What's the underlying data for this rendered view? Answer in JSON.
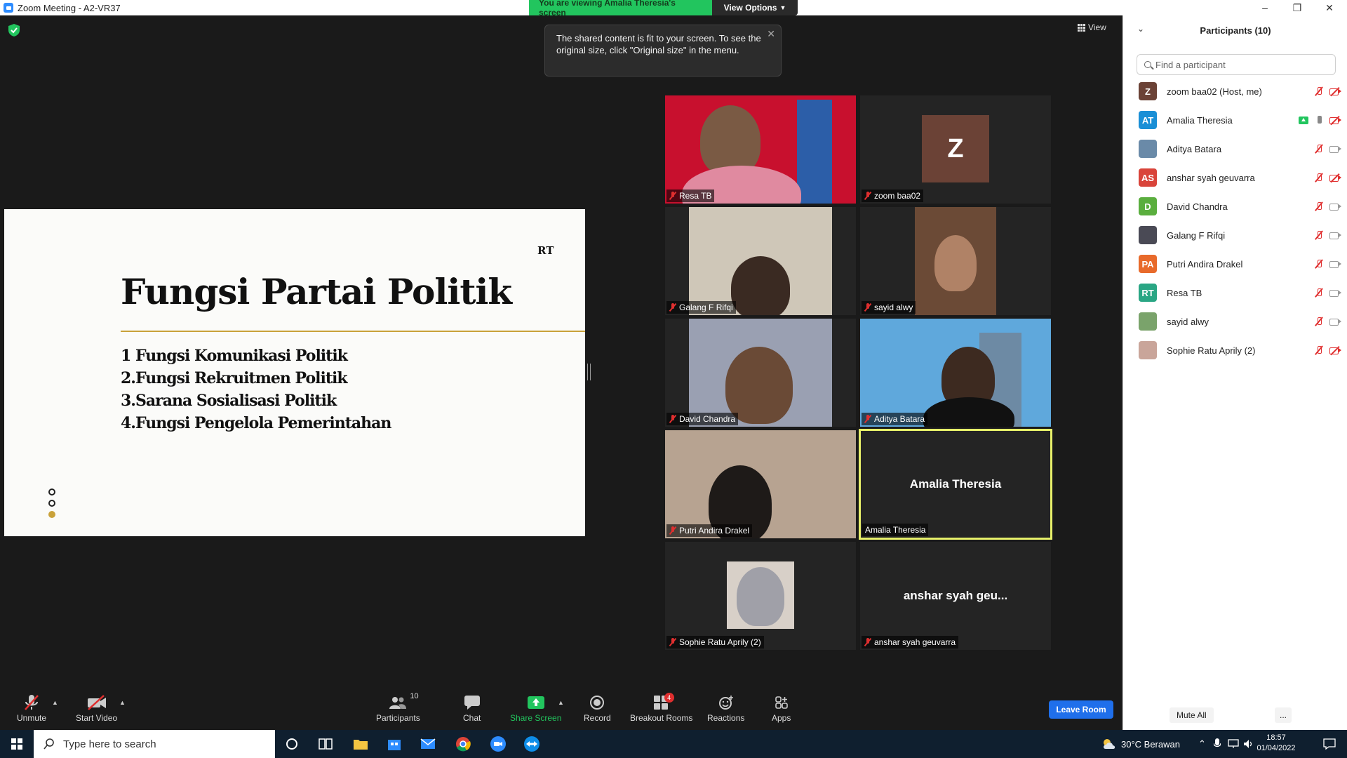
{
  "window": {
    "title": "Zoom Meeting - A2-VR37"
  },
  "share_banner": {
    "viewing": "You are viewing Amalia Theresia's screen",
    "view_options": "View Options"
  },
  "view_button": {
    "label": "View"
  },
  "tooltip": {
    "line1": "The shared content is fit to your screen. To see the",
    "line2": "original size, click \"Original size\" in the menu."
  },
  "slide": {
    "tag": "RT",
    "title": "Fungsi Partai Politik",
    "items": [
      "1 Fungsi Komunikasi Politik",
      "2.Fungsi Rekruitmen Politik",
      "3.Sarana Sosialisasi Politik",
      "4.Fungsi Pengelola Pemerintahan"
    ]
  },
  "video_tiles": [
    {
      "name": "Resa TB",
      "muted": true
    },
    {
      "name": "zoom baa02",
      "muted": true,
      "avatar_letter": "Z"
    },
    {
      "name": "Galang F Rifqi",
      "muted": true
    },
    {
      "name": "sayid alwy",
      "muted": true
    },
    {
      "name": "David Chandra",
      "muted": true
    },
    {
      "name": "Aditya Batara",
      "muted": true
    },
    {
      "name": "Putri Andira Drakel",
      "muted": true
    },
    {
      "name": "Amalia Theresia",
      "muted": false,
      "big_name": "Amalia Theresia",
      "active_speaker": true
    },
    {
      "name": "Sophie Ratu Aprily (2)",
      "muted": true
    },
    {
      "name": "anshar syah geuvarra",
      "muted": true,
      "big_name": "anshar syah geu..."
    }
  ],
  "toolbar": {
    "unmute": "Unmute",
    "start_video": "Start Video",
    "participants": "Participants",
    "participants_count": "10",
    "chat": "Chat",
    "share_screen": "Share Screen",
    "record": "Record",
    "breakout_rooms": "Breakout Rooms",
    "breakout_badge": "4",
    "reactions": "Reactions",
    "apps": "Apps",
    "leave_room": "Leave Room"
  },
  "participants_panel": {
    "title": "Participants (10)",
    "search_placeholder": "Find a participant",
    "mute_all": "Mute All",
    "more": "...",
    "list": [
      {
        "name": "zoom baa02 (Host, me)",
        "initials": "Z",
        "color": "#6b4236",
        "mic": "muted",
        "cam": "off"
      },
      {
        "name": "Amalia Theresia",
        "initials": "AT",
        "color": "#1a8fd6",
        "mic": "on",
        "cam": "off",
        "sharing": true
      },
      {
        "name": "Aditya Batara",
        "initials": "",
        "color": "#6a8aa8",
        "mic": "muted",
        "cam": "on"
      },
      {
        "name": "anshar syah geuvarra",
        "initials": "AS",
        "color": "#d9443a",
        "mic": "muted",
        "cam": "off"
      },
      {
        "name": "David Chandra",
        "initials": "D",
        "color": "#5aae3e",
        "mic": "muted",
        "cam": "on"
      },
      {
        "name": "Galang F Rifqi",
        "initials": "",
        "color": "#4a4a55",
        "mic": "muted",
        "cam": "on"
      },
      {
        "name": "Putri Andira Drakel",
        "initials": "PA",
        "color": "#e86a2b",
        "mic": "muted",
        "cam": "on"
      },
      {
        "name": "Resa TB",
        "initials": "RT",
        "color": "#2aa684",
        "mic": "muted",
        "cam": "on"
      },
      {
        "name": "sayid alwy",
        "initials": "",
        "color": "#7aa36b",
        "mic": "muted",
        "cam": "on"
      },
      {
        "name": "Sophie Ratu Aprily (2)",
        "initials": "",
        "color": "#c9a59a",
        "mic": "muted",
        "cam": "off"
      }
    ]
  },
  "taskbar": {
    "search_placeholder": "Type here to search",
    "weather": "30°C  Berawan",
    "time": "18:57",
    "date": "01/04/2022"
  }
}
